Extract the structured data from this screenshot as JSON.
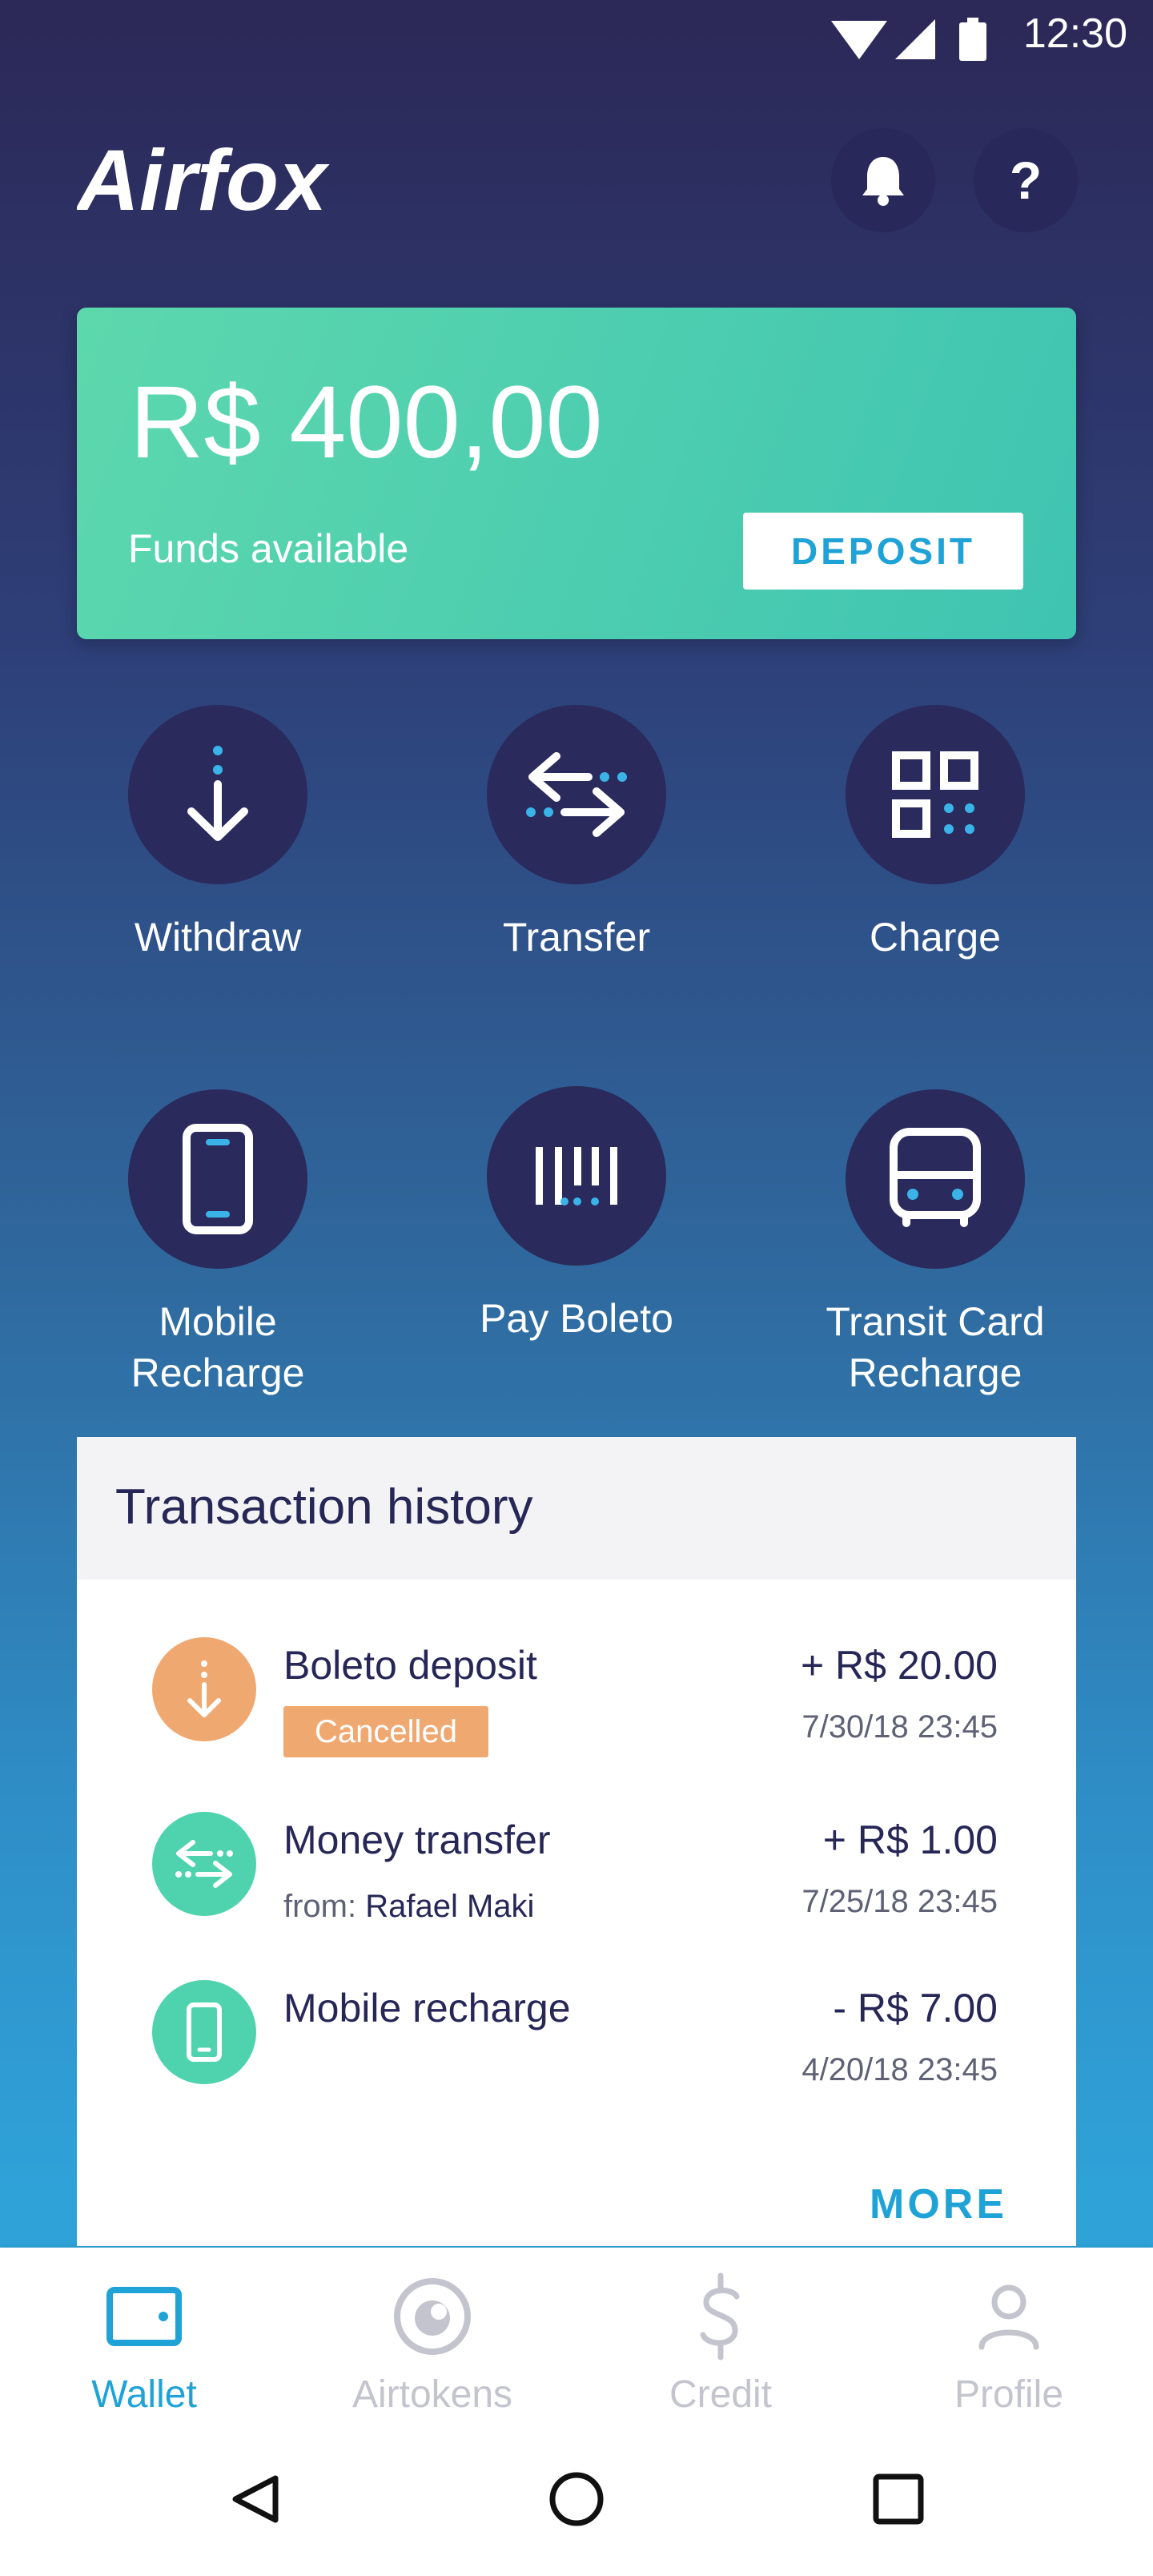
{
  "status_bar": {
    "time": "12:30",
    "icons": [
      "wifi-icon",
      "signal-icon",
      "battery-icon"
    ]
  },
  "header": {
    "logo_text": "Airfox",
    "bell_icon": "bell-icon",
    "help_label": "?"
  },
  "balance": {
    "amount": "R$ 400,00",
    "label": "Funds available",
    "deposit_label": "DEPOSIT"
  },
  "actions": [
    {
      "label": "Withdraw",
      "icon": "withdraw-icon"
    },
    {
      "label": "Transfer",
      "icon": "transfer-icon"
    },
    {
      "label": "Charge",
      "icon": "qr-charge-icon"
    },
    {
      "label": "Mobile Recharge",
      "icon": "mobile-icon"
    },
    {
      "label": "Pay Boleto",
      "icon": "barcode-icon"
    },
    {
      "label": "Transit Card Recharge",
      "icon": "bus-icon"
    }
  ],
  "transactions": {
    "title": "Transaction history",
    "items": [
      {
        "name": "Boleto deposit",
        "amount": "+ R$ 20.00",
        "date": "7/30/18 23:45",
        "badge": "Cancelled",
        "color": "#f0a871"
      },
      {
        "name": "Money transfer",
        "amount": "+ R$ 1.00",
        "date": "7/25/18 23:45",
        "sub_prefix": "from:",
        "sub_name": "Rafael Maki",
        "color": "#4fd3ae"
      },
      {
        "name": "Mobile recharge",
        "amount": "- R$ 7.00",
        "date": "4/20/18 23:45",
        "color": "#4fd3ae"
      }
    ],
    "more_label": "MORE"
  },
  "bottom_nav": [
    {
      "label": "Wallet",
      "icon": "wallet-icon",
      "active": true
    },
    {
      "label": "Airtokens",
      "icon": "airtokens-icon",
      "active": false
    },
    {
      "label": "Credit",
      "icon": "dollar-icon",
      "active": false
    },
    {
      "label": "Profile",
      "icon": "person-icon",
      "active": false
    }
  ],
  "colors": {
    "accent": "#1fa3d6",
    "dark": "#272757",
    "card_green": "#4fd3ae",
    "orange": "#f0a871"
  }
}
